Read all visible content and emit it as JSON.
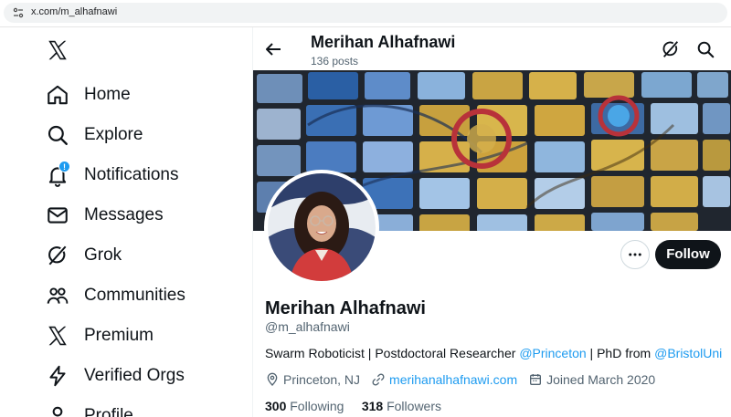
{
  "browser": {
    "url": "x.com/m_alhafnawi"
  },
  "sidebar": {
    "items": [
      {
        "label": "Home",
        "icon": "home-icon"
      },
      {
        "label": "Explore",
        "icon": "search-icon"
      },
      {
        "label": "Notifications",
        "icon": "bell-icon",
        "badge": "!"
      },
      {
        "label": "Messages",
        "icon": "envelope-icon"
      },
      {
        "label": "Grok",
        "icon": "grok-icon"
      },
      {
        "label": "Communities",
        "icon": "people-icon"
      },
      {
        "label": "Premium",
        "icon": "x-logo-icon"
      },
      {
        "label": "Verified Orgs",
        "icon": "lightning-icon"
      },
      {
        "label": "Profile",
        "icon": "person-icon"
      }
    ]
  },
  "header": {
    "name": "Merihan Alhafnawi",
    "posts": "136 posts"
  },
  "profile": {
    "name": "Merihan Alhafnawi",
    "handle": "@m_alhafnawi",
    "bio_text1": "Swarm Roboticist | Postdoctoral Researcher ",
    "bio_link1": "@Princeton",
    "bio_text2": " | PhD from ",
    "bio_link2": "@BristolUni",
    "location": "Princeton, NJ",
    "website": "merihanalhafnawi.com",
    "joined": "Joined March 2020",
    "following_count": "300",
    "following_label": "Following",
    "followers_count": "318",
    "followers_label": "Followers",
    "follow_label": "Follow"
  },
  "colors": {
    "accent": "#1d9bf0",
    "text": "#0f1419",
    "muted": "#536471",
    "follow_bg": "#0f1419"
  }
}
